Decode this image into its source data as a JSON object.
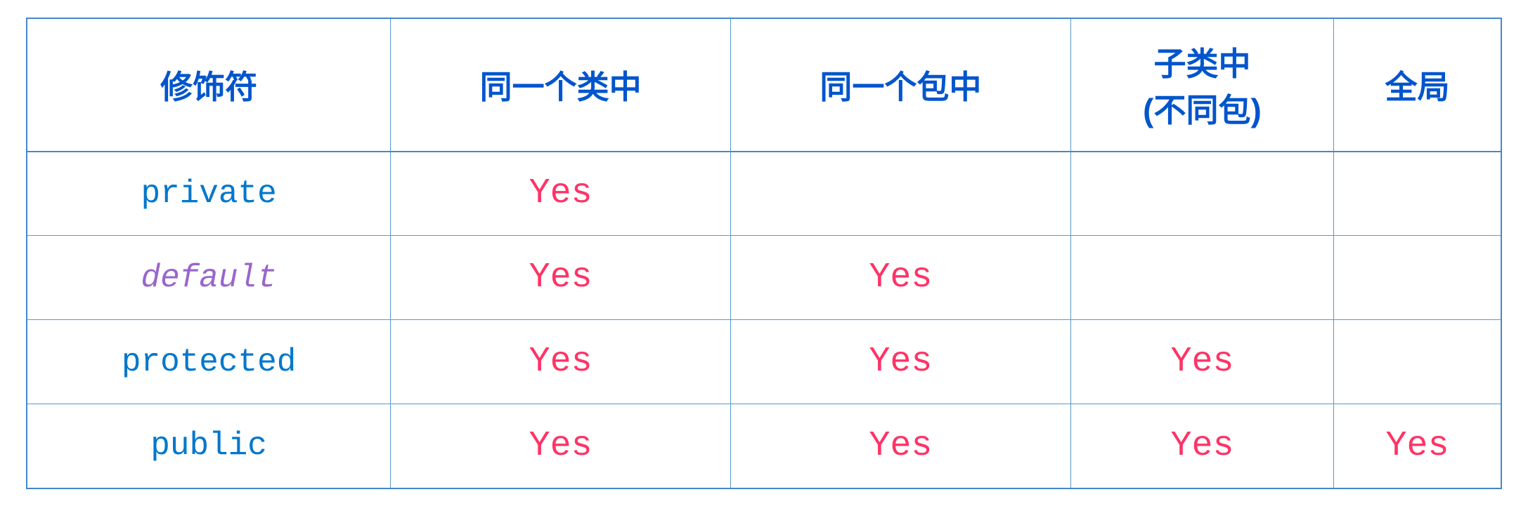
{
  "table": {
    "headers": [
      {
        "label": "修饰符",
        "key": "modifier"
      },
      {
        "label": "同一个类中",
        "key": "same_class"
      },
      {
        "label": "同一个包中",
        "key": "same_package"
      },
      {
        "label": "子类中\n(不同包)",
        "key": "subclass"
      },
      {
        "label": "全局",
        "key": "global"
      }
    ],
    "rows": [
      {
        "modifier": "private",
        "modifier_style": "normal",
        "same_class": "Yes",
        "same_package": "",
        "subclass": "",
        "global": ""
      },
      {
        "modifier": "default",
        "modifier_style": "italic",
        "same_class": "Yes",
        "same_package": "Yes",
        "subclass": "",
        "global": ""
      },
      {
        "modifier": "protected",
        "modifier_style": "normal",
        "same_class": "Yes",
        "same_package": "Yes",
        "subclass": "Yes",
        "global": ""
      },
      {
        "modifier": "public",
        "modifier_style": "normal",
        "same_class": "Yes",
        "same_package": "Yes",
        "subclass": "Yes",
        "global": "Yes"
      }
    ],
    "yes_label": "Yes"
  }
}
